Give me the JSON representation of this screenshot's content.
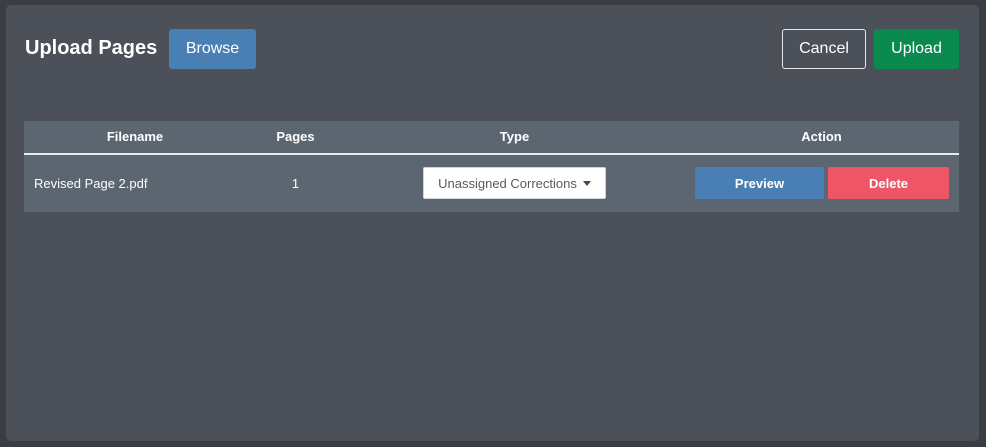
{
  "modal": {
    "title": "Upload Pages",
    "browse_label": "Browse",
    "cancel_label": "Cancel",
    "upload_label": "Upload"
  },
  "table": {
    "headers": {
      "filename": "Filename",
      "pages": "Pages",
      "type": "Type",
      "action": "Action"
    },
    "rows": [
      {
        "filename": "Revised Page 2.pdf",
        "pages": "1",
        "type": "Unassigned Corrections",
        "preview_label": "Preview",
        "delete_label": "Delete"
      }
    ]
  },
  "icons": {
    "type_dropdown": "caret-down-icon"
  },
  "colors": {
    "modal_background": "#4b5059",
    "table_background": "#5c6670",
    "primary_blue": "#4a7fb4",
    "success_green": "#0b8a50",
    "danger_red": "#ee5566"
  }
}
